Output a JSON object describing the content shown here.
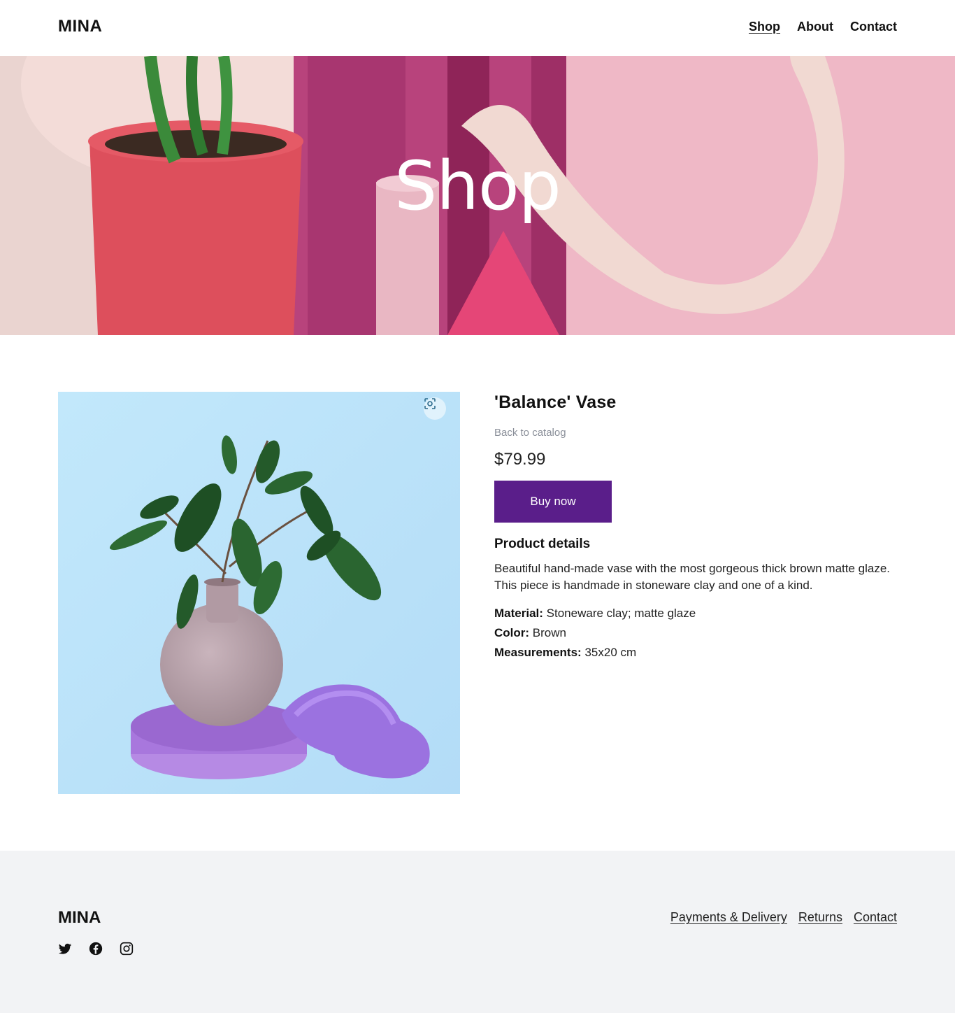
{
  "header": {
    "logo": "MINA",
    "nav": [
      {
        "label": "Shop",
        "active": true
      },
      {
        "label": "About",
        "active": false
      },
      {
        "label": "Contact",
        "active": false
      }
    ]
  },
  "hero": {
    "title": "Shop"
  },
  "product": {
    "title": "'Balance' Vase",
    "back_link": "Back to catalog",
    "price": "$79.99",
    "buy_label": "Buy now",
    "details_heading": "Product details",
    "description": "Beautiful hand-made vase with the most gorgeous thick brown matte glaze. This piece is handmade in stoneware clay and one of a kind.",
    "specs": [
      {
        "label": "Material:",
        "value": "Stoneware clay; matte glaze"
      },
      {
        "label": "Color:",
        "value": "Brown"
      },
      {
        "label": "Measurements:",
        "value": "35x20 cm"
      }
    ]
  },
  "footer": {
    "logo": "MINA",
    "social": [
      "twitter-icon",
      "facebook-icon",
      "instagram-icon"
    ],
    "links": [
      "Payments & Delivery",
      "Returns",
      "Contact"
    ]
  },
  "colors": {
    "accent": "#5a1e8a",
    "footer_bg": "#f2f3f5",
    "image_bg": "#bde5fa"
  }
}
